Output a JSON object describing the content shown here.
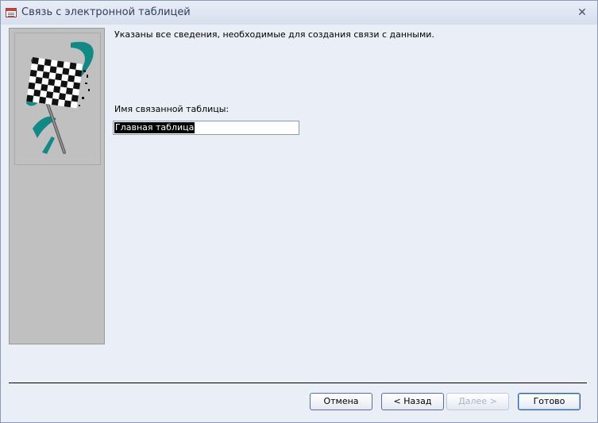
{
  "window": {
    "title": "Связь с электронной таблицей",
    "close_glyph": "✕"
  },
  "wizard": {
    "instruction": "Указаны все сведения, необходимые для создания связи с данными.",
    "field_label": "Имя связанной таблицы:",
    "field_value": "Главная таблица"
  },
  "buttons": {
    "cancel": "Отмена",
    "back": "< Назад",
    "next": "Далее >",
    "finish": "Готово"
  },
  "colors": {
    "accent": "#2b5fb2",
    "flag_teal": "#0f8a85",
    "panel_gray": "#c0c0c0"
  }
}
